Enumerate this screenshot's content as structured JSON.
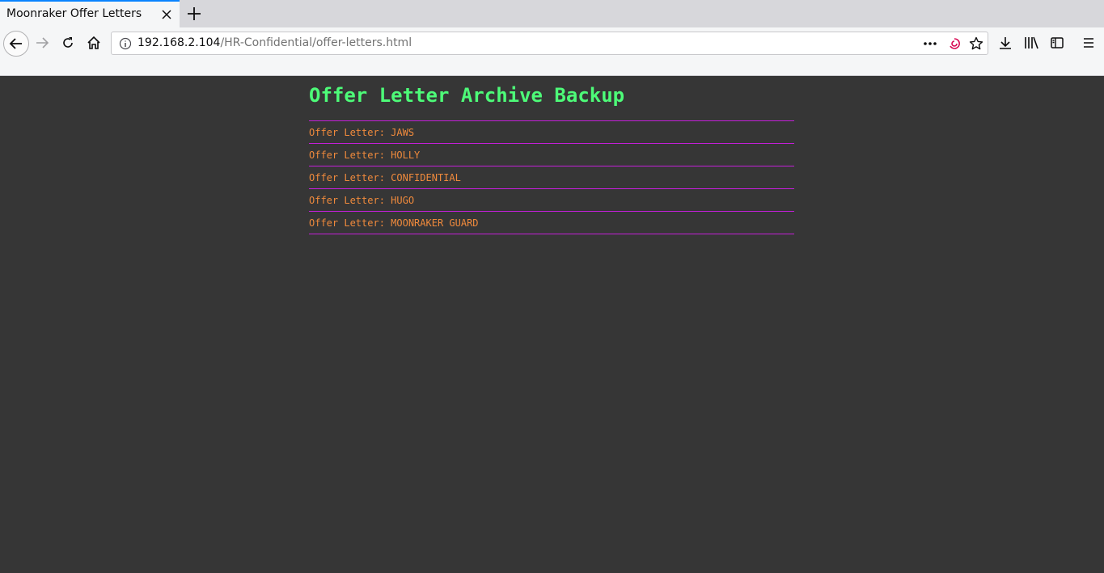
{
  "browser": {
    "tab": {
      "title": "Moonraker Offer Letters"
    },
    "url": {
      "host": "192.168.2.104",
      "path": "/HR-Confidential/offer-letters.html"
    }
  },
  "page": {
    "heading": "Offer Letter Archive Backup",
    "letters": [
      {
        "label": "Offer Letter: JAWS"
      },
      {
        "label": "Offer Letter: HOLLY"
      },
      {
        "label": "Offer Letter: CONFIDENTIAL"
      },
      {
        "label": "Offer Letter: HUGO"
      },
      {
        "label": "Offer Letter: MOONRAKER GUARD"
      }
    ]
  },
  "colors": {
    "background": "#363636",
    "heading": "#4dfb78",
    "link": "#f08a3c",
    "divider": "#c31fd8"
  }
}
